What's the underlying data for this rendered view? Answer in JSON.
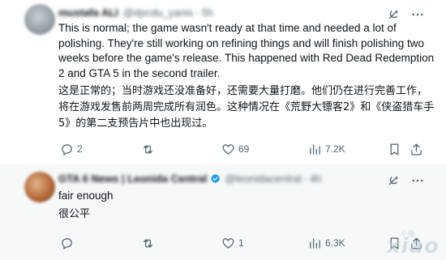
{
  "tweets": [
    {
      "author_name": "mustafa ALI",
      "author_handle": "@dpcdu_yanis",
      "time": "5h",
      "text_en": "This is normal; the game wasn't ready at that time and needed a lot of polishing. They're still working on refining things and will finish polishing two weeks before the game's release. This happened with Red Dead Redemption 2 and GTA 5 in the second trailer.",
      "text_zh": "这是正常的；当时游戏还没准备好，还需要大量打磨。他们仍在进行完善工作，将在游戏发售前两周完成所有润色。这种情况在《荒野大镖客2》和《侠盗猎车手5》的第二支预告片中也出现过。",
      "replies": "2",
      "reposts": "",
      "likes": "69",
      "views": "7.2K"
    },
    {
      "author_name": "GTA 6 News | Leonida Central",
      "author_handle": "@leonidacentral",
      "time": "4h",
      "text_en": "fair enough",
      "text_zh": "很公平",
      "replies": "",
      "reposts": "",
      "likes": "1",
      "views": "6.3K"
    }
  ],
  "watermark": {
    "main": "xiao",
    "sub": "小蚕"
  },
  "colors": {
    "text": "#0f1419",
    "muted": "#536471",
    "verified": "#1d9bf0"
  }
}
